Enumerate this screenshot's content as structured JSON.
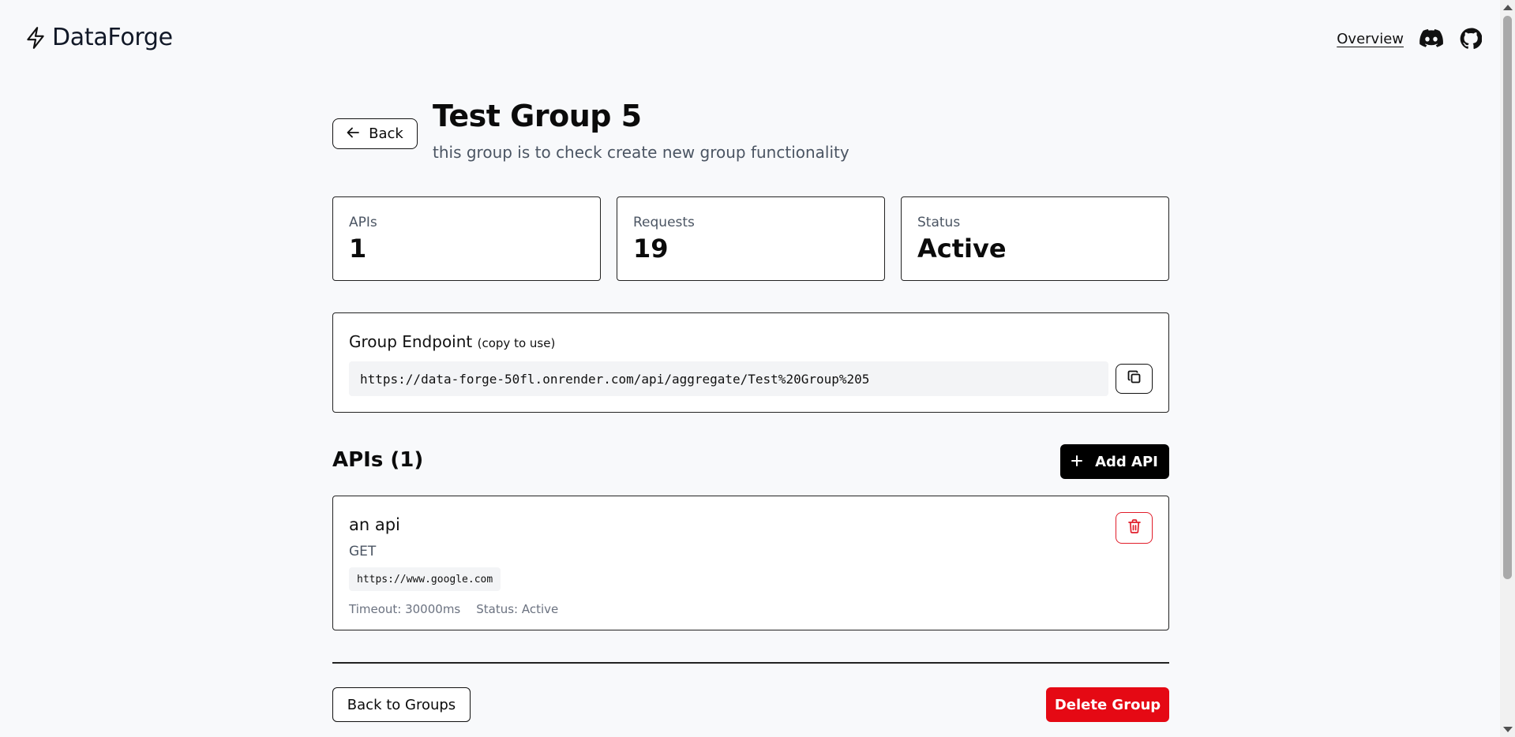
{
  "app": {
    "name": "DataForge",
    "logo_icon": "bolt-icon"
  },
  "nav": {
    "overview_label": "Overview",
    "discord_icon": "discord-icon",
    "github_icon": "github-icon"
  },
  "group": {
    "back_label": "Back",
    "title": "Test Group 5",
    "description": "this group is to check create new group functionality"
  },
  "stats": [
    {
      "label": "APIs",
      "value": "1"
    },
    {
      "label": "Requests",
      "value": "19"
    },
    {
      "label": "Status",
      "value": "Active"
    }
  ],
  "endpoint": {
    "title": "Group Endpoint",
    "hint": "(copy to use)",
    "url": "https://data-forge-50fl.onrender.com/api/aggregate/Test%20Group%205",
    "copy_icon": "copy-icon"
  },
  "apis": {
    "heading": "APIs (1)",
    "add_label": "Add API",
    "items": [
      {
        "name": "an api",
        "method": "GET",
        "url": "https://www.google.com",
        "timeout": "Timeout: 30000ms",
        "status": "Status: Active"
      }
    ]
  },
  "footer": {
    "back_to_groups": "Back to Groups",
    "delete_group": "Delete Group"
  },
  "colors": {
    "accent": "#000000",
    "danger": "#e50914",
    "background": "#f8f9fb"
  }
}
